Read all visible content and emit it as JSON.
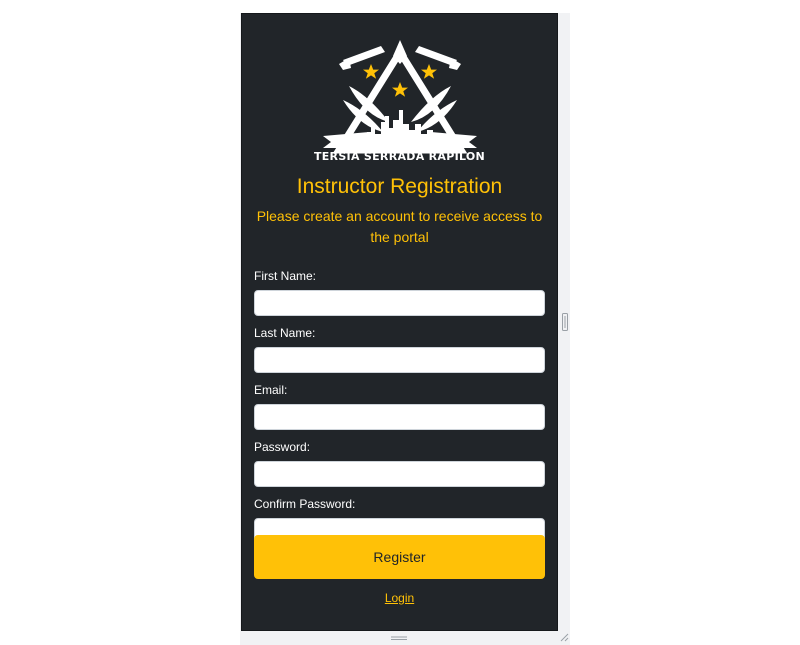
{
  "logo": {
    "text": "TERSIA SERRADA RAPILON",
    "icon": "crossed-swords-triangle-emblem"
  },
  "header": {
    "title": "Instructor Registration",
    "subtitle": "Please create an account to receive access to the portal"
  },
  "form": {
    "fields": [
      {
        "label": "First Name:",
        "value": "",
        "placeholder": "",
        "type": "text"
      },
      {
        "label": "Last Name:",
        "value": "",
        "placeholder": "",
        "type": "text"
      },
      {
        "label": "Email:",
        "value": "",
        "placeholder": "",
        "type": "email"
      },
      {
        "label": "Password:",
        "value": "",
        "placeholder": "",
        "type": "password"
      },
      {
        "label": "Confirm Password:",
        "value": "",
        "placeholder": "",
        "type": "password"
      }
    ],
    "submit_label": "Register",
    "login_label": "Login"
  },
  "colors": {
    "card_background": "#212529",
    "accent": "#ffc107",
    "text_light": "#ffffff"
  }
}
